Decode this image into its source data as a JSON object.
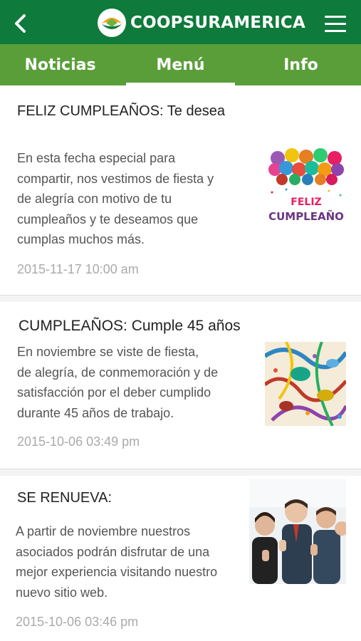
{
  "header": {
    "back_icon": "chevron-left-icon",
    "brand_name": "COOPSURAMERICA",
    "menu_icon": "hamburger-menu-icon",
    "color": "#0e7a3b"
  },
  "tabs": [
    {
      "label": "Noticias",
      "active": false
    },
    {
      "label": "Menú",
      "active": true
    },
    {
      "label": "Info",
      "active": false
    }
  ],
  "tab_bar_color": "#5a9e3a",
  "news": [
    {
      "title": "FELIZ CUMPLEAÑOS: Te desea",
      "body_lines": [
        "En esta fecha especial para",
        "compartir, nos vestimos de fiesta y",
        "de alegría con motivo de tu",
        "cumpleaños y te deseamos que",
        "cumplas muchos más."
      ],
      "date": "2015-11-17 10:00 am",
      "image_text_1": "FELIZ",
      "image_text_2": "CUMPLEAÑO"
    },
    {
      "title": "CUMPLEAÑOS:  Cumple 45 años",
      "body_lines": [
        "En noviembre  se viste de fiesta,",
        "de alegría, de conmemoración y de",
        "satisfacción por el deber cumplido",
        "durante 45 años de trabajo."
      ],
      "date": "2015-10-06 03:49 pm"
    },
    {
      "title": "SE RENUEVA:",
      "body_lines": [
        "A partir de noviembre nuestros",
        "asociados podrán disfrutar de una",
        "mejor experiencia visitando nuestro",
        "nuevo sitio web."
      ],
      "date": "2015-10-06 03:46 pm"
    }
  ]
}
